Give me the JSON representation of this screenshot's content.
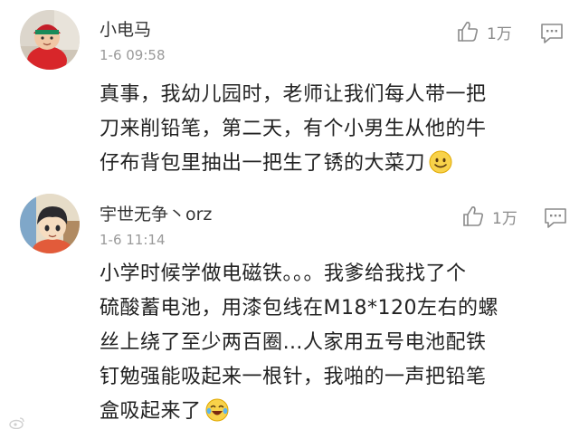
{
  "comments": [
    {
      "username": "小电马",
      "timestamp": "1-6 09:58",
      "likes": "1万",
      "lines": [
        "真事，我幼儿园时，老师让我们每人带一把",
        "刀来削铅笔，第二天，有个小男生从他的牛",
        "仔布背包里抽出一把生了锈的大菜刀"
      ],
      "avatar_icon": "child-photo-avatar",
      "emoji_icon": "smile-emoji-icon"
    },
    {
      "username": "宇世无争丶orz",
      "timestamp": "1-6 11:14",
      "likes": "1万",
      "lines": [
        "小学时候学做电磁铁。。。我爹给我找了个",
        "硫酸蓄电池，用漆包线在M18*120左右的螺",
        "丝上绕了至少两百圈…人家用五号电池配铁",
        "钉勉强能吸起来一根针，我啪的一声把铅笔",
        "盒吸起来了"
      ],
      "avatar_icon": "anime-boy-avatar",
      "emoji_icon": "laugh-tears-emoji-icon"
    }
  ],
  "icons": {
    "like": "thumbs-up-icon",
    "reply": "comment-reply-icon"
  },
  "colors": {
    "text": "#222222",
    "meta": "#9a9a9a",
    "icon": "#8a8a8a"
  }
}
